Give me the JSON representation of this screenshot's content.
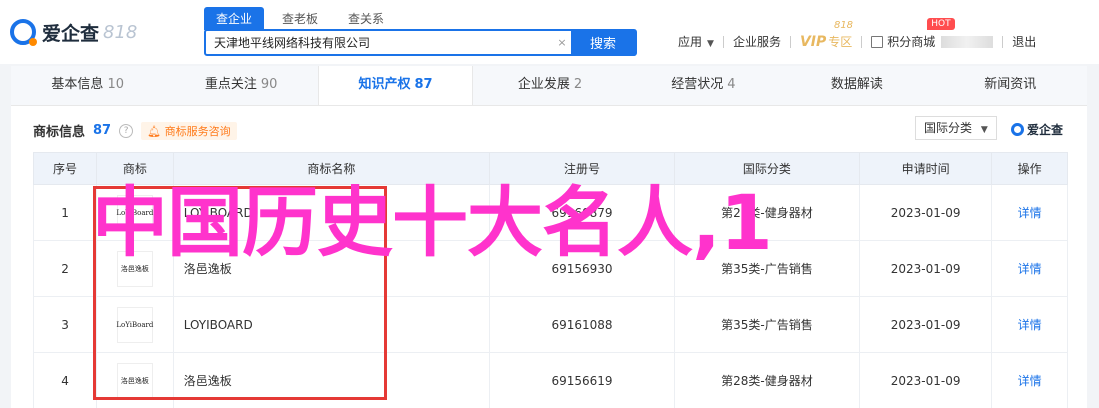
{
  "header": {
    "logo_text": "爱企查",
    "logo_num": "818",
    "search_tabs": [
      "查企业",
      "查老板",
      "查关系"
    ],
    "search_value": "天津地平线网络科技有限公司",
    "search_clear": "×",
    "search_button": "搜索",
    "nav": {
      "app": "应用",
      "service": "企业服务",
      "vip": "VIP",
      "vip_sub": "专区",
      "vip_818": "818",
      "points": "积分商城",
      "hot": "HOT",
      "logout": "退出"
    }
  },
  "tabs": [
    {
      "label": "基本信息",
      "count": "10"
    },
    {
      "label": "重点关注",
      "count": "90"
    },
    {
      "label": "知识产权",
      "count": "87"
    },
    {
      "label": "企业发展",
      "count": "2"
    },
    {
      "label": "经营状况",
      "count": "4"
    },
    {
      "label": "数据解读",
      "count": ""
    },
    {
      "label": "新闻资讯",
      "count": ""
    }
  ],
  "section": {
    "title": "商标信息",
    "count": "87",
    "help": "?",
    "consult": "商标服务咨询",
    "filter": "国际分类",
    "brand": "爱企查"
  },
  "table": {
    "headers": [
      "序号",
      "商标",
      "商标名称",
      "注册号",
      "国际分类",
      "申请时间",
      "操作"
    ],
    "rows": [
      {
        "no": "1",
        "logo": "LoYiBoard",
        "name": "LOYIBOARD",
        "reg": "69160879",
        "cls": "第28类-健身器材",
        "date": "2023-01-09",
        "op": "详情"
      },
      {
        "no": "2",
        "logo": "洛邑逸板",
        "name": "洛邑逸板",
        "reg": "69156930",
        "cls": "第35类-广告销售",
        "date": "2023-01-09",
        "op": "详情"
      },
      {
        "no": "3",
        "logo": "LoYiBoard",
        "name": "LOYIBOARD",
        "reg": "69161088",
        "cls": "第35类-广告销售",
        "date": "2023-01-09",
        "op": "详情"
      },
      {
        "no": "4",
        "logo": "洛邑逸板",
        "name": "洛邑逸板",
        "reg": "69156619",
        "cls": "第28类-健身器材",
        "date": "2023-01-09",
        "op": "详情"
      }
    ]
  },
  "overlay_text": "中国历史十大名人,1",
  "colors": {
    "accent": "#1a73e8",
    "overlay": "#ff33cc",
    "box": "#e53935"
  }
}
